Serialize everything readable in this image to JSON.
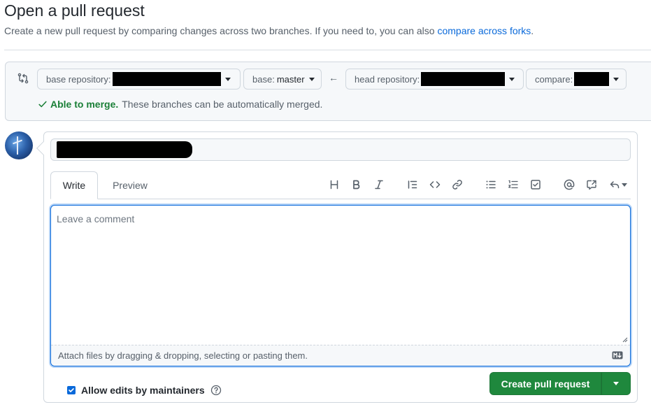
{
  "header": {
    "title": "Open a pull request",
    "subtitle": "Create a new pull request by comparing changes across two branches. If you need to, you can also ",
    "subtitle_link": "compare across forks",
    "subtitle_end": "."
  },
  "compare": {
    "icon": "git-compare-icon",
    "base_repo_label": "base repository:",
    "base_label": "base:",
    "base_value": "master",
    "arrow": "←",
    "head_repo_label": "head repository:",
    "compare_label": "compare:",
    "merge_status_strong": "Able to merge.",
    "merge_status_text": "These branches can be automatically merged.",
    "check_color": "#1a7f37"
  },
  "editor": {
    "tabs": {
      "write": "Write",
      "preview": "Preview"
    },
    "toolbar": [
      "heading-icon",
      "bold-icon",
      "italic-icon",
      "quote-icon",
      "code-icon",
      "link-icon",
      "unordered-list-icon",
      "ordered-list-icon",
      "task-list-icon",
      "mention-icon",
      "cross-reference-icon",
      "reply-icon"
    ],
    "comment_placeholder": "Leave a comment",
    "attach_text": "Attach files by dragging & dropping, selecting or pasting them."
  },
  "footer": {
    "allow_edits_label": "Allow edits by maintainers",
    "create_button": "Create pull request",
    "accent": "#1f883d"
  }
}
